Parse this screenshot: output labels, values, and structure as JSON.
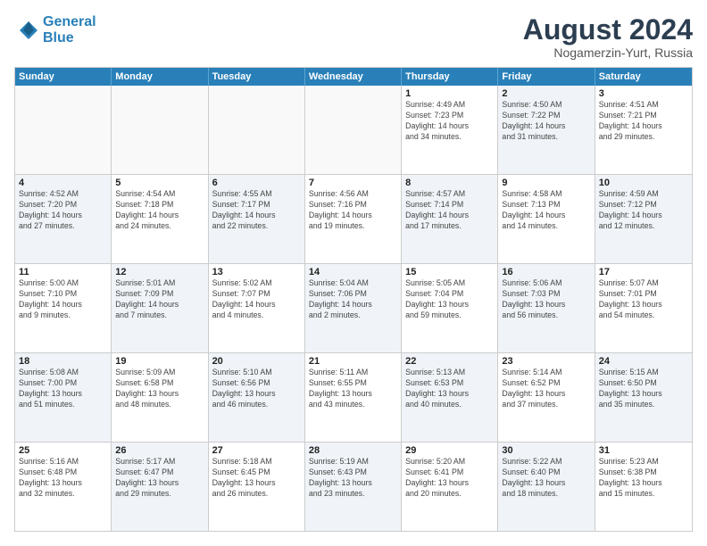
{
  "header": {
    "logo_line1": "General",
    "logo_line2": "Blue",
    "month_year": "August 2024",
    "location": "Nogamerzin-Yurt, Russia"
  },
  "weekdays": [
    "Sunday",
    "Monday",
    "Tuesday",
    "Wednesday",
    "Thursday",
    "Friday",
    "Saturday"
  ],
  "weeks": [
    [
      {
        "day": "",
        "info": "",
        "shaded": false,
        "empty": true
      },
      {
        "day": "",
        "info": "",
        "shaded": false,
        "empty": true
      },
      {
        "day": "",
        "info": "",
        "shaded": false,
        "empty": true
      },
      {
        "day": "",
        "info": "",
        "shaded": false,
        "empty": true
      },
      {
        "day": "1",
        "info": "Sunrise: 4:49 AM\nSunset: 7:23 PM\nDaylight: 14 hours\nand 34 minutes.",
        "shaded": false
      },
      {
        "day": "2",
        "info": "Sunrise: 4:50 AM\nSunset: 7:22 PM\nDaylight: 14 hours\nand 31 minutes.",
        "shaded": true
      },
      {
        "day": "3",
        "info": "Sunrise: 4:51 AM\nSunset: 7:21 PM\nDaylight: 14 hours\nand 29 minutes.",
        "shaded": false
      }
    ],
    [
      {
        "day": "4",
        "info": "Sunrise: 4:52 AM\nSunset: 7:20 PM\nDaylight: 14 hours\nand 27 minutes.",
        "shaded": true
      },
      {
        "day": "5",
        "info": "Sunrise: 4:54 AM\nSunset: 7:18 PM\nDaylight: 14 hours\nand 24 minutes.",
        "shaded": false
      },
      {
        "day": "6",
        "info": "Sunrise: 4:55 AM\nSunset: 7:17 PM\nDaylight: 14 hours\nand 22 minutes.",
        "shaded": true
      },
      {
        "day": "7",
        "info": "Sunrise: 4:56 AM\nSunset: 7:16 PM\nDaylight: 14 hours\nand 19 minutes.",
        "shaded": false
      },
      {
        "day": "8",
        "info": "Sunrise: 4:57 AM\nSunset: 7:14 PM\nDaylight: 14 hours\nand 17 minutes.",
        "shaded": true
      },
      {
        "day": "9",
        "info": "Sunrise: 4:58 AM\nSunset: 7:13 PM\nDaylight: 14 hours\nand 14 minutes.",
        "shaded": false
      },
      {
        "day": "10",
        "info": "Sunrise: 4:59 AM\nSunset: 7:12 PM\nDaylight: 14 hours\nand 12 minutes.",
        "shaded": true
      }
    ],
    [
      {
        "day": "11",
        "info": "Sunrise: 5:00 AM\nSunset: 7:10 PM\nDaylight: 14 hours\nand 9 minutes.",
        "shaded": false
      },
      {
        "day": "12",
        "info": "Sunrise: 5:01 AM\nSunset: 7:09 PM\nDaylight: 14 hours\nand 7 minutes.",
        "shaded": true
      },
      {
        "day": "13",
        "info": "Sunrise: 5:02 AM\nSunset: 7:07 PM\nDaylight: 14 hours\nand 4 minutes.",
        "shaded": false
      },
      {
        "day": "14",
        "info": "Sunrise: 5:04 AM\nSunset: 7:06 PM\nDaylight: 14 hours\nand 2 minutes.",
        "shaded": true
      },
      {
        "day": "15",
        "info": "Sunrise: 5:05 AM\nSunset: 7:04 PM\nDaylight: 13 hours\nand 59 minutes.",
        "shaded": false
      },
      {
        "day": "16",
        "info": "Sunrise: 5:06 AM\nSunset: 7:03 PM\nDaylight: 13 hours\nand 56 minutes.",
        "shaded": true
      },
      {
        "day": "17",
        "info": "Sunrise: 5:07 AM\nSunset: 7:01 PM\nDaylight: 13 hours\nand 54 minutes.",
        "shaded": false
      }
    ],
    [
      {
        "day": "18",
        "info": "Sunrise: 5:08 AM\nSunset: 7:00 PM\nDaylight: 13 hours\nand 51 minutes.",
        "shaded": true
      },
      {
        "day": "19",
        "info": "Sunrise: 5:09 AM\nSunset: 6:58 PM\nDaylight: 13 hours\nand 48 minutes.",
        "shaded": false
      },
      {
        "day": "20",
        "info": "Sunrise: 5:10 AM\nSunset: 6:56 PM\nDaylight: 13 hours\nand 46 minutes.",
        "shaded": true
      },
      {
        "day": "21",
        "info": "Sunrise: 5:11 AM\nSunset: 6:55 PM\nDaylight: 13 hours\nand 43 minutes.",
        "shaded": false
      },
      {
        "day": "22",
        "info": "Sunrise: 5:13 AM\nSunset: 6:53 PM\nDaylight: 13 hours\nand 40 minutes.",
        "shaded": true
      },
      {
        "day": "23",
        "info": "Sunrise: 5:14 AM\nSunset: 6:52 PM\nDaylight: 13 hours\nand 37 minutes.",
        "shaded": false
      },
      {
        "day": "24",
        "info": "Sunrise: 5:15 AM\nSunset: 6:50 PM\nDaylight: 13 hours\nand 35 minutes.",
        "shaded": true
      }
    ],
    [
      {
        "day": "25",
        "info": "Sunrise: 5:16 AM\nSunset: 6:48 PM\nDaylight: 13 hours\nand 32 minutes.",
        "shaded": false
      },
      {
        "day": "26",
        "info": "Sunrise: 5:17 AM\nSunset: 6:47 PM\nDaylight: 13 hours\nand 29 minutes.",
        "shaded": true
      },
      {
        "day": "27",
        "info": "Sunrise: 5:18 AM\nSunset: 6:45 PM\nDaylight: 13 hours\nand 26 minutes.",
        "shaded": false
      },
      {
        "day": "28",
        "info": "Sunrise: 5:19 AM\nSunset: 6:43 PM\nDaylight: 13 hours\nand 23 minutes.",
        "shaded": true
      },
      {
        "day": "29",
        "info": "Sunrise: 5:20 AM\nSunset: 6:41 PM\nDaylight: 13 hours\nand 20 minutes.",
        "shaded": false
      },
      {
        "day": "30",
        "info": "Sunrise: 5:22 AM\nSunset: 6:40 PM\nDaylight: 13 hours\nand 18 minutes.",
        "shaded": true
      },
      {
        "day": "31",
        "info": "Sunrise: 5:23 AM\nSunset: 6:38 PM\nDaylight: 13 hours\nand 15 minutes.",
        "shaded": false
      }
    ]
  ]
}
